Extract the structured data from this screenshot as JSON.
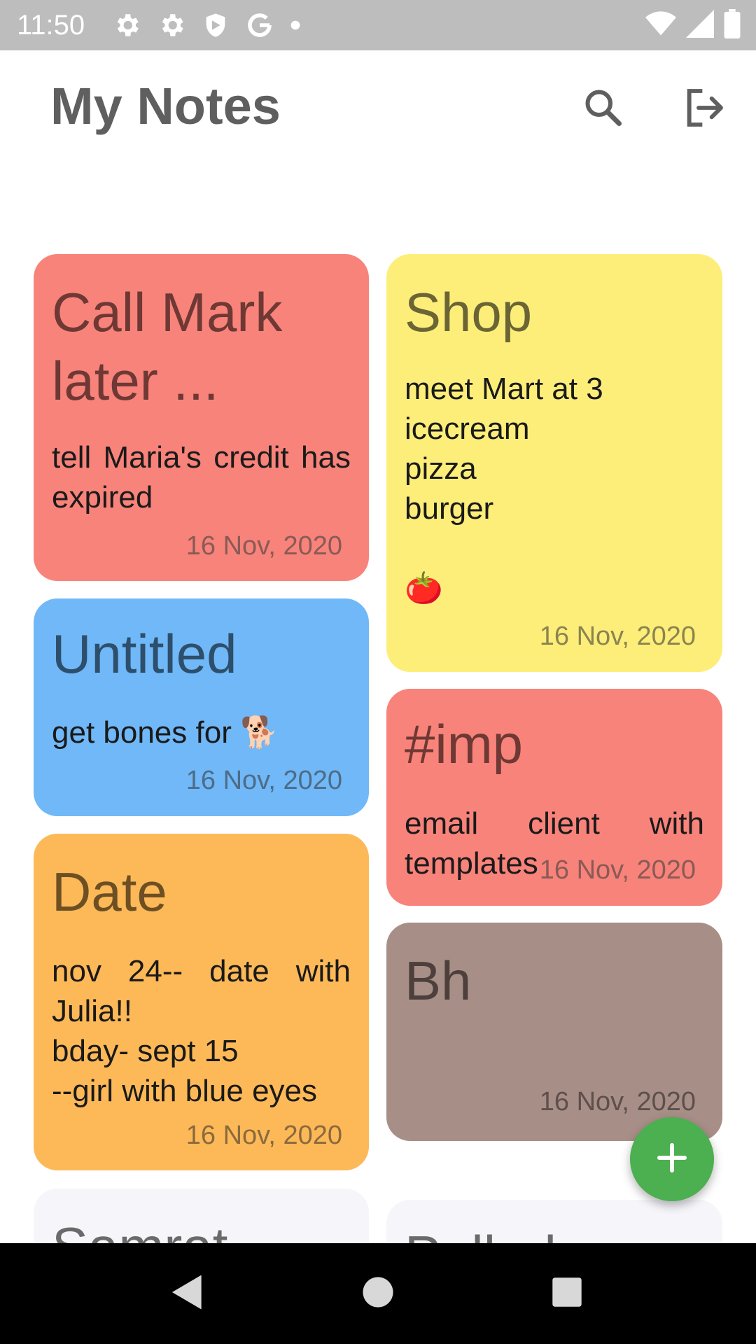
{
  "status_bar": {
    "time": "11:50",
    "left_icons": [
      "settings-icon",
      "settings-icon",
      "shield-icon",
      "google-icon",
      "dot-icon"
    ],
    "right_icons": [
      "wifi-icon",
      "signal-icon",
      "battery-icon"
    ]
  },
  "app_bar": {
    "title": "My Notes",
    "actions": [
      "search-icon",
      "logout-icon"
    ]
  },
  "notes": [
    {
      "id": "call-mark",
      "title": "Call Mark later ...",
      "body": "tell Maria's credit has expired",
      "date": "16 Nov, 2020",
      "color": "#f8837a"
    },
    {
      "id": "untitled",
      "title": "Untitled",
      "body": "get bones for 🐕",
      "date": "16 Nov, 2020",
      "color": "#70b8f7"
    },
    {
      "id": "date",
      "title": "Date",
      "body_lines": [
        "nov 24-- date with Julia!!",
        "bday- sept 15",
        "--girl with blue eyes"
      ],
      "date": "16 Nov, 2020",
      "color": "#fdb957"
    },
    {
      "id": "samrat",
      "title": "Samrat",
      "color": "#f5f5fa"
    },
    {
      "id": "shop",
      "title": "Shop",
      "body_lines": [
        "meet Mart at 3",
        "icecream",
        "pizza",
        "burger",
        "",
        "🍅"
      ],
      "date": "16 Nov, 2020",
      "color": "#fdee7a"
    },
    {
      "id": "imp",
      "title": "#imp",
      "body": "email client with templates",
      "date": "16 Nov, 2020",
      "color": "#f8837a"
    },
    {
      "id": "bh",
      "title": "Bh",
      "date": "16 Nov, 2020",
      "color": "#a78f88"
    },
    {
      "id": "partial",
      "title": "Pallad",
      "color": "#f5f5fa"
    }
  ],
  "fab": {
    "icon": "plus-icon",
    "color": "#4caf50"
  },
  "nav_bar": {
    "buttons": [
      "back-icon",
      "home-icon",
      "recents-icon"
    ]
  }
}
